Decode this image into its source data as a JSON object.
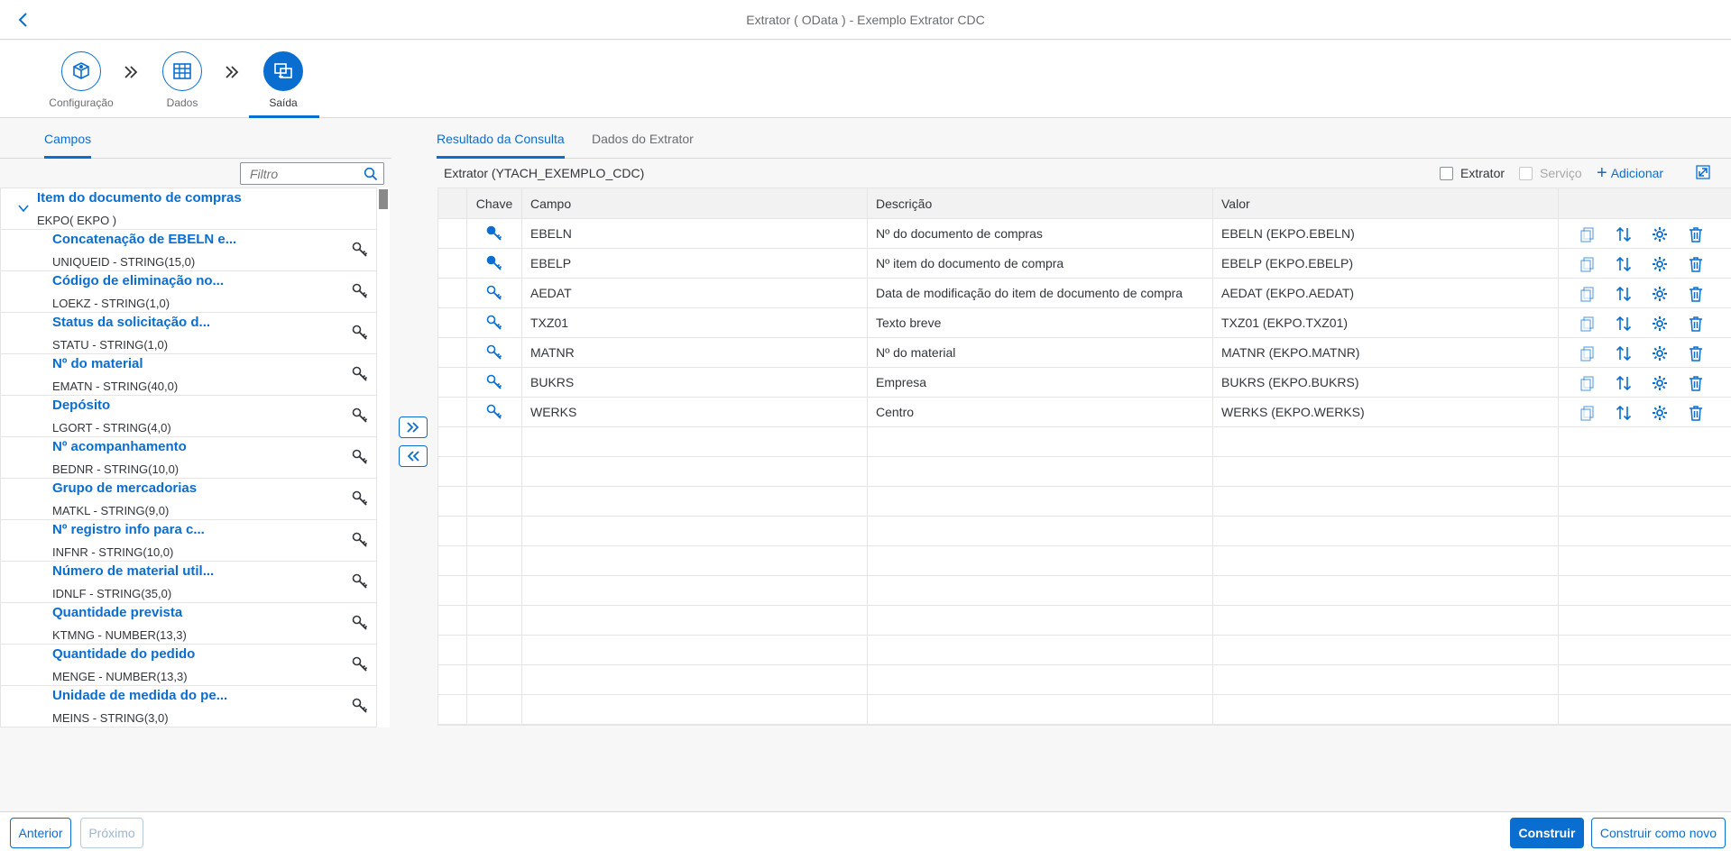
{
  "shell": {
    "title": "Extrator ( OData ) - Exemplo Extrator CDC"
  },
  "wizard": {
    "steps": [
      {
        "label": "Configuração",
        "icon": "settings-cube-icon"
      },
      {
        "label": "Dados",
        "icon": "table-grid-icon"
      },
      {
        "label": "Saída",
        "icon": "output-screens-icon"
      }
    ],
    "active_step": "Saída"
  },
  "left": {
    "tab": "Campos",
    "filter_placeholder": "Filtro",
    "group": {
      "title": "Item do documento de compras",
      "subtitle": "EKPO( EKPO )"
    },
    "items": [
      {
        "name": "Concatenação de EBELN e...",
        "meta": "UNIQUEID - STRING(15,0)"
      },
      {
        "name": "Código de eliminação no...",
        "meta": "LOEKZ - STRING(1,0)"
      },
      {
        "name": "Status da solicitação d...",
        "meta": "STATU - STRING(1,0)"
      },
      {
        "name": "Nº do material",
        "meta": "EMATN - STRING(40,0)"
      },
      {
        "name": "Depósito",
        "meta": "LGORT - STRING(4,0)"
      },
      {
        "name": "Nº acompanhamento",
        "meta": "BEDNR - STRING(10,0)"
      },
      {
        "name": "Grupo de mercadorias",
        "meta": "MATKL - STRING(9,0)"
      },
      {
        "name": "Nº registro info para c...",
        "meta": "INFNR - STRING(10,0)"
      },
      {
        "name": "Número de material util...",
        "meta": "IDNLF - STRING(35,0)"
      },
      {
        "name": "Quantidade prevista",
        "meta": "KTMNG - NUMBER(13,3)"
      },
      {
        "name": "Quantidade do pedido",
        "meta": "MENGE - NUMBER(13,3)"
      },
      {
        "name": "Unidade de medida do pe...",
        "meta": "MEINS - STRING(3,0)"
      }
    ]
  },
  "right": {
    "tabs": [
      "Resultado da Consulta",
      "Dados do Extrator"
    ],
    "active_tab": "Resultado da Consulta",
    "toolbar": {
      "title": "Extrator (YTACH_EXEMPLO_CDC)",
      "extrator_label": "Extrator",
      "servico_label": "Serviço",
      "add_label": "Adicionar"
    },
    "columns": [
      "Chave",
      "Campo",
      "Descrição",
      "Valor"
    ],
    "rows": [
      {
        "key": true,
        "campo": "EBELN",
        "descricao": "Nº do documento de compras",
        "valor": "EBELN (EKPO.EBELN)"
      },
      {
        "key": true,
        "campo": "EBELP",
        "descricao": "Nº item do documento de compra",
        "valor": "EBELP (EKPO.EBELP)"
      },
      {
        "key": false,
        "campo": "AEDAT",
        "descricao": "Data de modificação do item de documento de compra",
        "valor": "AEDAT (EKPO.AEDAT)"
      },
      {
        "key": false,
        "campo": "TXZ01",
        "descricao": "Texto breve",
        "valor": "TXZ01 (EKPO.TXZ01)"
      },
      {
        "key": false,
        "campo": "MATNR",
        "descricao": "Nº do material",
        "valor": "MATNR (EKPO.MATNR)"
      },
      {
        "key": false,
        "campo": "BUKRS",
        "descricao": "Empresa",
        "valor": "BUKRS (EKPO.BUKRS)"
      },
      {
        "key": false,
        "campo": "WERKS",
        "descricao": "Centro",
        "valor": "WERKS (EKPO.WERKS)"
      }
    ],
    "empty_rows": 10
  },
  "footer": {
    "anterior": "Anterior",
    "proximo": "Próximo",
    "construir": "Construir",
    "construir_novo": "Construir como novo"
  },
  "colors": {
    "accent": "#0a6ed1",
    "text": "#32363a",
    "muted": "#6a6d70"
  }
}
